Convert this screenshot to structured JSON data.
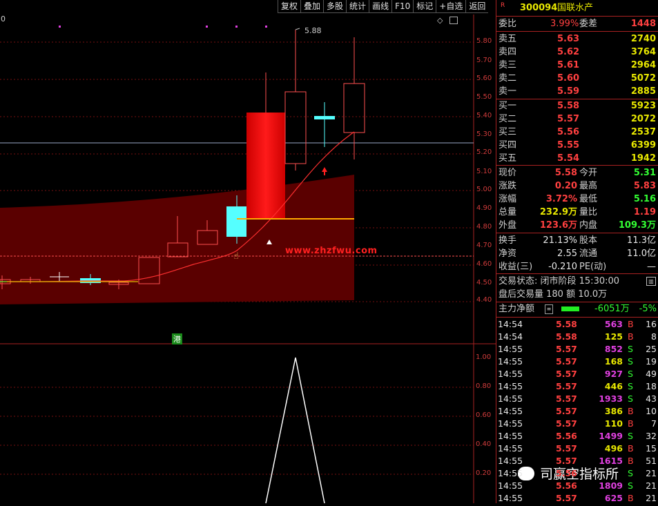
{
  "toolbar": [
    "复权",
    "叠加",
    "多股",
    "统计",
    "画线",
    "F10",
    "标记",
    "+自选",
    "返回"
  ],
  "chart": {
    "top_left_value": "0",
    "peak_label": "5.88",
    "price_ticks": [
      "5.80",
      "5.70",
      "5.60",
      "5.50",
      "5.40",
      "5.30",
      "5.20",
      "5.10",
      "5.00",
      "4.90",
      "4.80",
      "4.70",
      "4.60",
      "4.50",
      "4.40"
    ],
    "indicator_ticks": [
      "1.00",
      "0.80",
      "0.60",
      "0.40",
      "0.20"
    ],
    "watermark": "www.zhzfwu.com",
    "badge": "港",
    "brand": "司赢空指标所",
    "diamond_icon": "diamond-icon",
    "window_icon": "window-icon"
  },
  "stock": {
    "r_mark": "R",
    "code": "300094",
    "name": "国联水产"
  },
  "weibi": {
    "label1": "委比",
    "value1": "3.99%",
    "label2": "委差",
    "value2": "1448"
  },
  "asks": [
    {
      "label": "卖五",
      "price": "5.63",
      "vol": "2740"
    },
    {
      "label": "卖四",
      "price": "5.62",
      "vol": "3764"
    },
    {
      "label": "卖三",
      "price": "5.61",
      "vol": "2964"
    },
    {
      "label": "卖二",
      "price": "5.60",
      "vol": "5072"
    },
    {
      "label": "卖一",
      "price": "5.59",
      "vol": "2885"
    }
  ],
  "bids": [
    {
      "label": "买一",
      "price": "5.58",
      "vol": "5923"
    },
    {
      "label": "买二",
      "price": "5.57",
      "vol": "2072"
    },
    {
      "label": "买三",
      "price": "5.56",
      "vol": "2537"
    },
    {
      "label": "买四",
      "price": "5.55",
      "vol": "6399"
    },
    {
      "label": "买五",
      "price": "5.54",
      "vol": "1942"
    }
  ],
  "quote": [
    {
      "l1": "现价",
      "v1": "5.58",
      "c1": "red",
      "l2": "今开",
      "v2": "5.31",
      "c2": "green"
    },
    {
      "l1": "涨跌",
      "v1": "0.20",
      "c1": "red",
      "l2": "最高",
      "v2": "5.83",
      "c2": "red"
    },
    {
      "l1": "涨幅",
      "v1": "3.72%",
      "c1": "red",
      "l2": "最低",
      "v2": "5.16",
      "c2": "green"
    },
    {
      "l1": "总量",
      "v1": "232.9万",
      "c1": "yellow",
      "l2": "量比",
      "v2": "1.19",
      "c2": "red"
    },
    {
      "l1": "外盘",
      "v1": "123.6万",
      "c1": "red",
      "l2": "内盘",
      "v2": "109.3万",
      "c2": "green"
    }
  ],
  "stats": [
    {
      "l1": "换手",
      "v1": "21.13%",
      "l2": "股本",
      "v2": "11.3亿"
    },
    {
      "l1": "净资",
      "v1": "2.55",
      "l2": "流通",
      "v2": "11.0亿"
    },
    {
      "l1": "收益(三)",
      "v1": "-0.210",
      "l2": "PE(动)",
      "v2": "—"
    }
  ],
  "trade_status": {
    "text": "交易状态: 闭市阶段 15:30:00"
  },
  "after_hours": {
    "text": "盘后交易量 180 额 10.0万"
  },
  "main_flow": {
    "label": "主力净额",
    "value": "-6051万",
    "pct": "-5%"
  },
  "ticks": [
    {
      "t": "14:54",
      "p": "5.58",
      "v": "563",
      "bs": "B",
      "n": "16",
      "vc": "magenta"
    },
    {
      "t": "14:54",
      "p": "5.58",
      "v": "125",
      "bs": "B",
      "n": "8",
      "vc": "yellow"
    },
    {
      "t": "14:55",
      "p": "5.57",
      "v": "852",
      "bs": "S",
      "n": "25",
      "vc": "magenta"
    },
    {
      "t": "14:55",
      "p": "5.57",
      "v": "168",
      "bs": "S",
      "n": "19",
      "vc": "yellow"
    },
    {
      "t": "14:55",
      "p": "5.57",
      "v": "927",
      "bs": "S",
      "n": "49",
      "vc": "magenta"
    },
    {
      "t": "14:55",
      "p": "5.57",
      "v": "446",
      "bs": "S",
      "n": "18",
      "vc": "yellow"
    },
    {
      "t": "14:55",
      "p": "5.57",
      "v": "1933",
      "bs": "S",
      "n": "43",
      "vc": "magenta"
    },
    {
      "t": "14:55",
      "p": "5.57",
      "v": "386",
      "bs": "B",
      "n": "10",
      "vc": "yellow"
    },
    {
      "t": "14:55",
      "p": "5.57",
      "v": "110",
      "bs": "B",
      "n": "7",
      "vc": "yellow"
    },
    {
      "t": "14:55",
      "p": "5.56",
      "v": "1499",
      "bs": "S",
      "n": "32",
      "vc": "magenta"
    },
    {
      "t": "14:55",
      "p": "5.57",
      "v": "496",
      "bs": "B",
      "n": "15",
      "vc": "yellow"
    },
    {
      "t": "14:55",
      "p": "5.57",
      "v": "1615",
      "bs": "B",
      "n": "51",
      "vc": "magenta"
    },
    {
      "t": "14:55",
      "p": "5.56",
      "v": "",
      "bs": "S",
      "n": "21",
      "vc": "magenta"
    },
    {
      "t": "14:55",
      "p": "5.56",
      "v": "1809",
      "bs": "S",
      "n": "21",
      "vc": "magenta"
    },
    {
      "t": "14:55",
      "p": "5.57",
      "v": "625",
      "bs": "B",
      "n": "21",
      "vc": "magenta"
    }
  ]
}
